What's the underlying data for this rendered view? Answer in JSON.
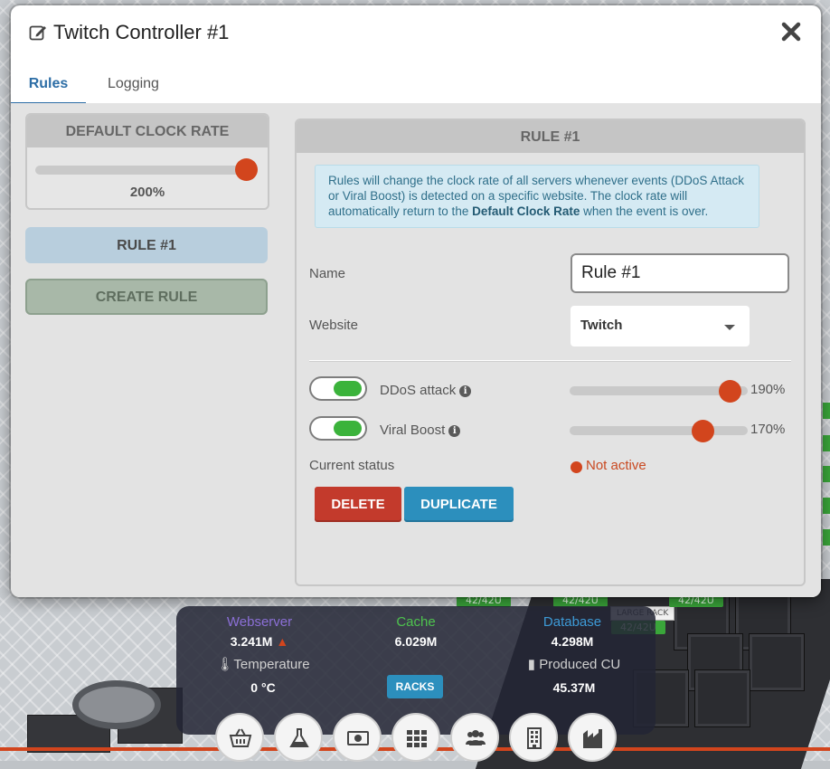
{
  "modal": {
    "title": "Twitch Controller #1",
    "tabs": [
      {
        "label": "Rules",
        "active": true
      },
      {
        "label": "Logging",
        "active": false
      }
    ]
  },
  "default_clock": {
    "header": "DEFAULT CLOCK RATE",
    "value_label": "200%",
    "fraction": 1.0
  },
  "rules_list": [
    {
      "label": "RULE #1",
      "selected": true
    }
  ],
  "create_rule_label": "CREATE RULE",
  "rule": {
    "header": "RULE #1",
    "info_text_1": "Rules will change the clock rate of all servers whenever events (DDoS Attack or Viral Boost) is detected on a specific website. The clock rate will automatically return to the ",
    "info_bold": "Default Clock Rate",
    "info_text_2": " when the event is over.",
    "name_label": "Name",
    "name_value": "Rule #1",
    "website_label": "Website",
    "website_value": "Twitch",
    "events": [
      {
        "label": "DDoS attack",
        "enabled": true,
        "value_label": "190%",
        "fraction": 0.9
      },
      {
        "label": "Viral Boost",
        "enabled": true,
        "value_label": "170%",
        "fraction": 0.75
      }
    ],
    "status_label": "Current status",
    "status_value": "Not active",
    "delete_label": "DELETE",
    "duplicate_label": "DUPLICATE"
  },
  "hud": {
    "webserver": {
      "label": "Webserver",
      "value": "3.241M",
      "color": "#8b6fd6"
    },
    "cache": {
      "label": "Cache",
      "value": "6.029M",
      "color": "#4ec34e"
    },
    "database": {
      "label": "Database",
      "value": "4.298M",
      "color": "#3d9ad6"
    },
    "temperature": {
      "label": "Temperature",
      "value": "0 °C"
    },
    "produced": {
      "label": "Produced CU",
      "value": "45.37M"
    },
    "racks_label": "RACKS",
    "buttons": [
      "basket-icon",
      "flask-icon",
      "money-icon",
      "grid-icon",
      "users-icon",
      "building-icon",
      "factory-icon"
    ]
  },
  "scene": {
    "rack_label": "LARGE RACK",
    "rack_capacity": "42/42U"
  },
  "colors": {
    "accent": "#2d6ea6",
    "slider": "#d2451d",
    "toggle_on": "#3bb33b",
    "delete": "#c33a2c",
    "duplicate": "#2c8fbd"
  }
}
